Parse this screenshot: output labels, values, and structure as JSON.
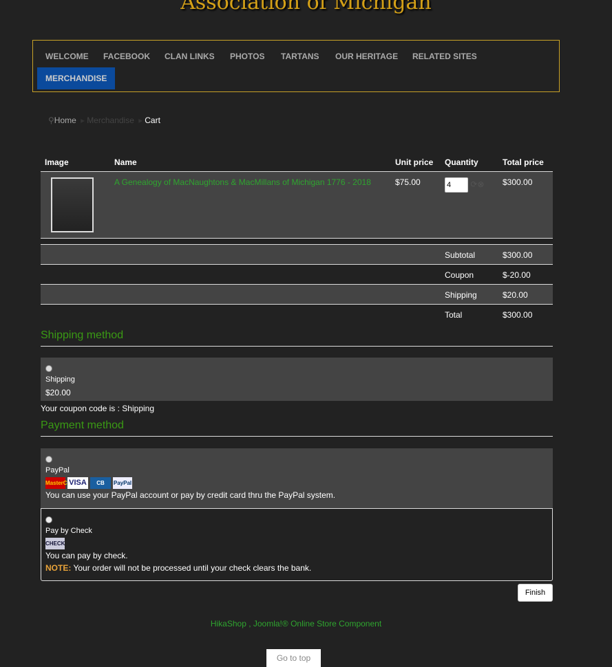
{
  "banner": "Association of Michigan",
  "nav": [
    "WELCOME",
    "FACEBOOK",
    "CLAN LINKS",
    "PHOTOS",
    "TARTANS",
    "OUR HERITAGE",
    "RELATED SITES",
    "MERCHANDISE"
  ],
  "breadcrumb": [
    "Home",
    "Merchandise",
    "Cart"
  ],
  "table": {
    "headers": [
      "Image",
      "Name",
      "Unit price",
      "Quantity",
      "Total price"
    ],
    "item": {
      "name": "A Genealogy of MacNaughtons & MacMillans of Michigan 1776 - 2018",
      "unit_price": "$75.00",
      "quantity": "4",
      "total": "$300.00"
    }
  },
  "totals": [
    {
      "label": "Subtotal",
      "value": "$300.00"
    },
    {
      "label": "Coupon",
      "value": "$-20.00"
    },
    {
      "label": "Shipping",
      "value": "$20.00"
    },
    {
      "label": "Total",
      "value": "$300.00"
    }
  ],
  "shipping": {
    "title": "Shipping method",
    "option": "Shipping",
    "price": "$20.00",
    "coupon_note": "Your coupon code is : Shipping"
  },
  "payment": {
    "title": "Payment method",
    "paypal": {
      "label": "PayPal",
      "cards": [
        "MasterCard",
        "VISA",
        "CB",
        "PayPal"
      ],
      "desc": "You can use your PayPal account or pay by credit card thru the PayPal system."
    },
    "check": {
      "label": "Pay by Check",
      "badge": "CHECK",
      "desc": "You can pay by check.",
      "note_label": "NOTE:",
      "note": " Your order will not be processed until your check clears the bank."
    }
  },
  "finish": "Finish",
  "footer": "HikaShop , Joomla!® Online Store Component",
  "top": "Go to top"
}
